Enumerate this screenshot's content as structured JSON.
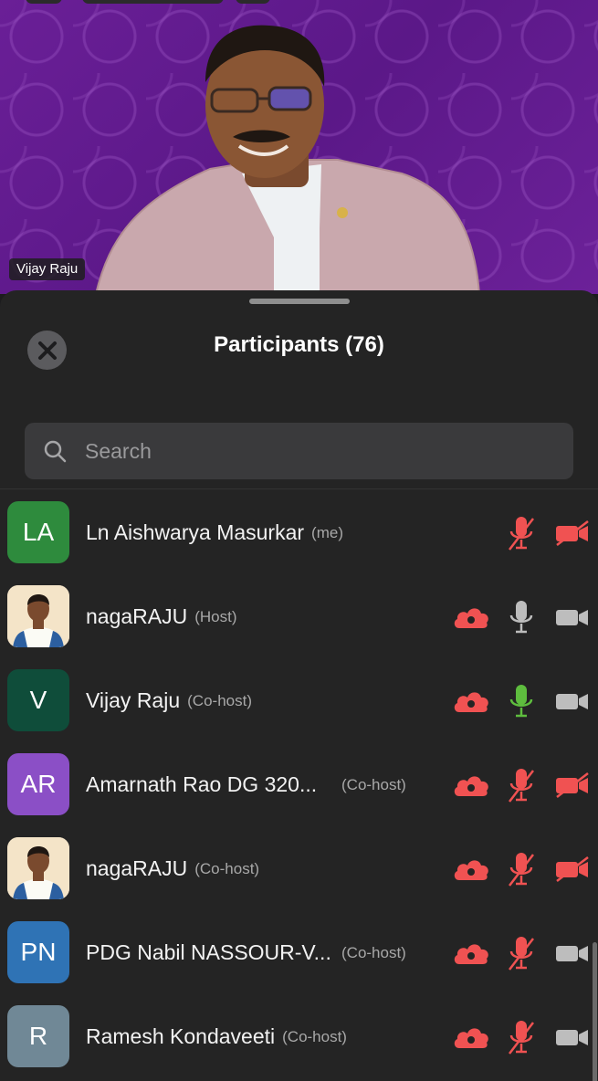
{
  "video": {
    "speaker_label": "Vijay Raju"
  },
  "panel": {
    "title": "Participants (76)",
    "close_icon": "close-icon",
    "search_placeholder": "Search"
  },
  "colors": {
    "muted_red": "#f05252",
    "mic_active_green": "#5ebd3e",
    "icon_gray": "#bdbdbd"
  },
  "participants": [
    {
      "initials": "LA",
      "avatar_color": "#2e8b3d",
      "photo": false,
      "name": "Ln Aishwarya Masurkar",
      "role": "(me)",
      "cloud": false,
      "mic": "muted",
      "video": "off"
    },
    {
      "initials": "",
      "avatar_color": "#f4e4c8",
      "photo": true,
      "name": "nagaRAJU",
      "role": "(Host)",
      "cloud": true,
      "mic": "on",
      "video": "on"
    },
    {
      "initials": "V",
      "avatar_color": "#0f4d3a",
      "photo": false,
      "name": "Vijay Raju",
      "role": "(Co-host)",
      "cloud": true,
      "mic": "speaking",
      "video": "on"
    },
    {
      "initials": "AR",
      "avatar_color": "#8b4fc6",
      "photo": false,
      "name": "Amarnath Rao DG 320...",
      "role": "(Co-host)",
      "cloud": true,
      "mic": "muted",
      "video": "off"
    },
    {
      "initials": "",
      "avatar_color": "#f4e4c8",
      "photo": true,
      "name": "nagaRAJU",
      "role": "(Co-host)",
      "cloud": true,
      "mic": "muted",
      "video": "off"
    },
    {
      "initials": "PN",
      "avatar_color": "#2f73b5",
      "photo": false,
      "name": "PDG Nabil NASSOUR-V...",
      "role": "(Co-host)",
      "cloud": true,
      "mic": "muted",
      "video": "on"
    },
    {
      "initials": "R",
      "avatar_color": "#708896",
      "photo": false,
      "name": "Ramesh Kondaveeti",
      "role": "(Co-host)",
      "cloud": true,
      "mic": "muted",
      "video": "on"
    }
  ]
}
